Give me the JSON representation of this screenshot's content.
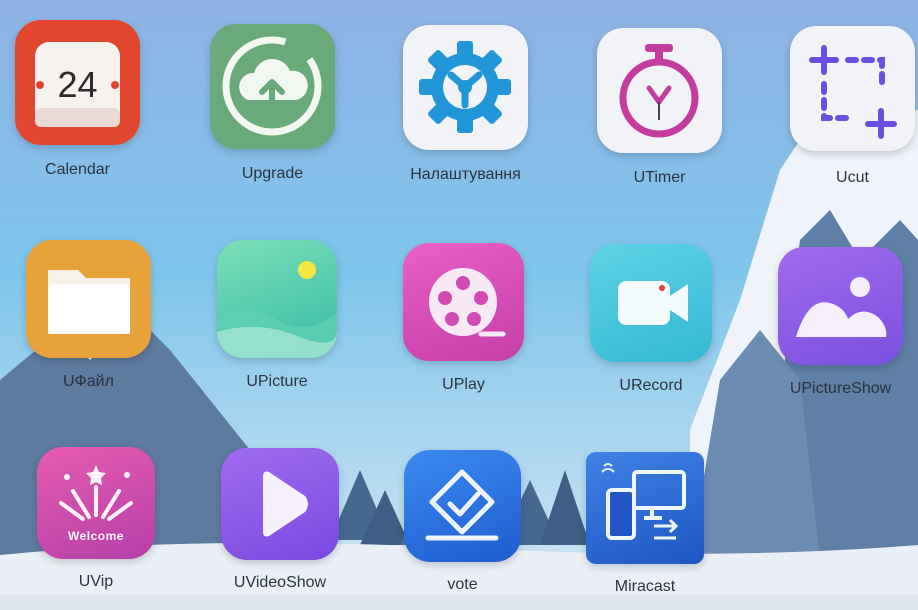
{
  "launcher": {
    "apps": [
      {
        "name": "calendar",
        "label": "Calendar",
        "icon": "calendar-icon",
        "icon_text": "24",
        "color": "#e2462f"
      },
      {
        "name": "upgrade",
        "label": "Upgrade",
        "icon": "cloud-upload-icon",
        "color": "#6aa979"
      },
      {
        "name": "settings",
        "label": "Налаштування",
        "icon": "gear-icon",
        "color": "#2196d8"
      },
      {
        "name": "utimer",
        "label": "UTimer",
        "icon": "stopwatch-icon",
        "color": "#c43c9e"
      },
      {
        "name": "ucut",
        "label": "Ucut",
        "icon": "crop-icon",
        "color": "#6a4fe0"
      },
      {
        "name": "ufile",
        "label": "UФайл",
        "icon": "folder-icon",
        "color": "#e8a23a"
      },
      {
        "name": "upicture",
        "label": "UPicture",
        "icon": "landscape-icon",
        "color": "#3fc4a8"
      },
      {
        "name": "uplay",
        "label": "UPlay",
        "icon": "film-reel-icon",
        "color": "#d94fb8"
      },
      {
        "name": "urecord",
        "label": "URecord",
        "icon": "video-camera-icon",
        "color": "#3cc0d6"
      },
      {
        "name": "upictureshow",
        "label": "UPictureShow",
        "icon": "photo-icon",
        "color": "#8e5be6"
      },
      {
        "name": "uvip",
        "label": "UVip",
        "icon": "fireworks-icon",
        "icon_text": "Welcome",
        "color": "#d64aa6"
      },
      {
        "name": "uvideoshow",
        "label": "UVideoShow",
        "icon": "play-icon",
        "color": "#8f5be8"
      },
      {
        "name": "vote",
        "label": "vote",
        "icon": "ballot-check-icon",
        "color": "#2a6fe0"
      },
      {
        "name": "miracast",
        "label": "Miracast",
        "icon": "screen-mirror-icon",
        "color": "#2a66d4"
      }
    ]
  }
}
